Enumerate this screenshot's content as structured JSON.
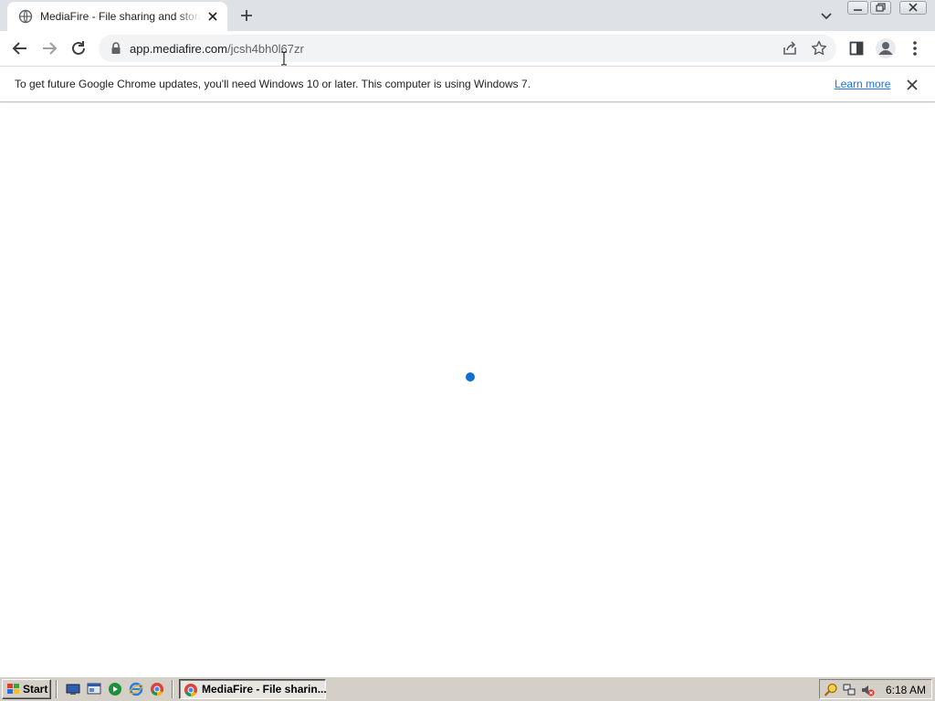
{
  "browser": {
    "tab": {
      "title": "MediaFire - File sharing and storage"
    },
    "address_bar": {
      "host": "app.mediafire.com",
      "path": "/jcsh4bh0l67zr"
    },
    "infobar": {
      "message": "To get future Google Chrome updates, you'll need Windows 10 or later. This computer is using Windows 7.",
      "link_label": "Learn more"
    }
  },
  "page": {
    "state": "loading",
    "spinner_color": "#0f6fd3"
  },
  "taskbar": {
    "start_label": "Start",
    "task_button_label": "MediaFire - File sharin...",
    "clock": "6:18 AM",
    "quick_launch": [
      "show-desktop-icon",
      "explorer-icon",
      "media-player-icon",
      "internet-explorer-icon",
      "chrome-icon"
    ]
  },
  "colors": {
    "accent": "#1a73e8",
    "tab_strip": "#dee1e6",
    "taskbar": "#d4d0c8"
  }
}
